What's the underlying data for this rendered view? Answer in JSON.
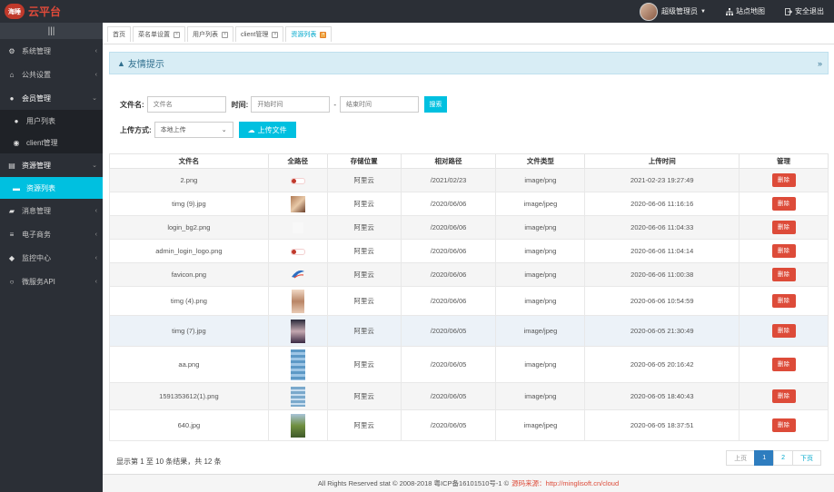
{
  "brand": {
    "badge": "海睡",
    "name": "云平台"
  },
  "topbar": {
    "user": "超级管理员",
    "sitemap": "站点地图",
    "logout": "安全退出"
  },
  "sidebar": {
    "toggle": "|||",
    "items": [
      {
        "label": "系统管理",
        "icon": "gear-icon"
      },
      {
        "label": "公共设置",
        "icon": "bank-icon"
      },
      {
        "label": "会员管理",
        "icon": "user-icon"
      },
      {
        "label": "用户列表",
        "icon": "user-icon"
      },
      {
        "label": "client管理",
        "icon": "group-icon"
      },
      {
        "label": "资源管理",
        "icon": "folder-icon"
      },
      {
        "label": "资源列表",
        "icon": "folder-open-icon"
      },
      {
        "label": "消息管理",
        "icon": "car-icon"
      },
      {
        "label": "电子商务",
        "icon": "sliders-icon"
      },
      {
        "label": "监控中心",
        "icon": "cube-icon"
      },
      {
        "label": "微服务API",
        "icon": "circle-icon"
      }
    ]
  },
  "tabs": [
    {
      "label": "首页"
    },
    {
      "label": "菜名单设置"
    },
    {
      "label": "用户列表"
    },
    {
      "label": "client管理"
    },
    {
      "label": "资源列表"
    }
  ],
  "alert": {
    "title": "友情提示"
  },
  "search": {
    "filename_label": "文件名:",
    "filename_placeholder": "文件名",
    "time_label": "时间:",
    "start_placeholder": "开始时间",
    "dash": "-",
    "end_placeholder": "结束时间",
    "search_btn": "搜索",
    "upload_label": "上传方式:",
    "upload_method": "本地上传",
    "upload_btn": "上传文件"
  },
  "table": {
    "headers": [
      "文件名",
      "全路径",
      "存储位置",
      "相对路径",
      "文件类型",
      "上传时间",
      "管理"
    ],
    "delete_label": "删除",
    "rows": [
      {
        "name": "2.png",
        "storage": "阿里云",
        "path": "/2021/02/23",
        "type": "image/png",
        "time": "2021-02-23 19:27:49"
      },
      {
        "name": "timg (9).jpg",
        "storage": "阿里云",
        "path": "/2020/06/06",
        "type": "image/jpeg",
        "time": "2020-06-06 11:16:16"
      },
      {
        "name": "login_bg2.png",
        "storage": "阿里云",
        "path": "/2020/06/06",
        "type": "image/png",
        "time": "2020-06-06 11:04:33"
      },
      {
        "name": "admin_login_logo.png",
        "storage": "阿里云",
        "path": "/2020/06/06",
        "type": "image/png",
        "time": "2020-06-06 11:04:14"
      },
      {
        "name": "favicon.png",
        "storage": "阿里云",
        "path": "/2020/06/06",
        "type": "image/png",
        "time": "2020-06-06 11:00:38"
      },
      {
        "name": "timg (4).png",
        "storage": "阿里云",
        "path": "/2020/06/06",
        "type": "image/png",
        "time": "2020-06-06 10:54:59"
      },
      {
        "name": "timg (7).jpg",
        "storage": "阿里云",
        "path": "/2020/06/05",
        "type": "image/jpeg",
        "time": "2020-06-05 21:30:49"
      },
      {
        "name": "aa.png",
        "storage": "阿里云",
        "path": "/2020/06/05",
        "type": "image/png",
        "time": "2020-06-05 20:16:42"
      },
      {
        "name": "1591353612(1).png",
        "storage": "阿里云",
        "path": "/2020/06/05",
        "type": "image/png",
        "time": "2020-06-05 18:40:43"
      },
      {
        "name": "640.jpg",
        "storage": "阿里云",
        "path": "/2020/06/05",
        "type": "image/jpeg",
        "time": "2020-06-05 18:37:51"
      }
    ]
  },
  "pagination": {
    "info": "显示第 1 至 10 条结果，共 12 条",
    "prev": "上页",
    "p1": "1",
    "p2": "2",
    "next": "下页"
  },
  "footer": {
    "text": "All Rights Reserved stat © 2008-2018 粤ICP备16101510号-1 ©",
    "source": "源码来源：http://minglisoft.cn/cloud"
  },
  "colors": {
    "accent": "#00c0e0",
    "danger": "#dd4b39",
    "sidebar": "#2b2f36"
  }
}
